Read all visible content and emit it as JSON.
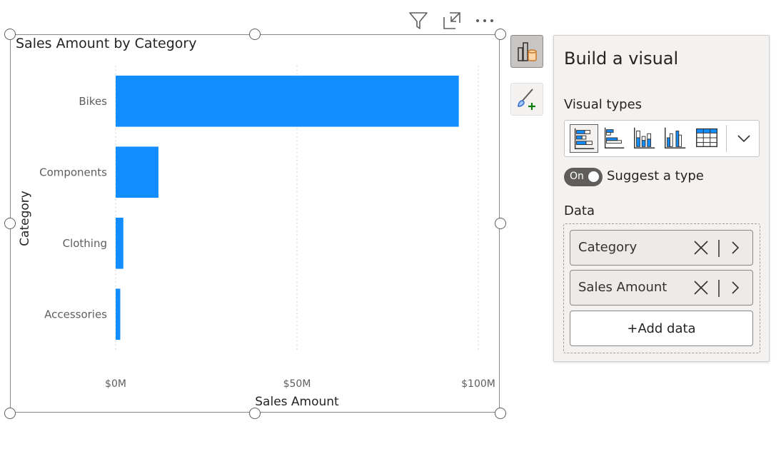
{
  "visual": {
    "title": "Sales Amount by Category"
  },
  "header_icons": [
    "filter-icon",
    "focus-mode-icon",
    "more-options-icon"
  ],
  "side_buttons": [
    "build-visual-icon",
    "format-visual-icon"
  ],
  "chart_data": {
    "type": "bar",
    "orientation": "horizontal",
    "title": "Sales Amount by Category",
    "categories": [
      "Bikes",
      "Components",
      "Clothing",
      "Accessories"
    ],
    "values": [
      94620526,
      11799077,
      2117613,
      1272057
    ],
    "xlabel": "Sales Amount",
    "ylabel": "Category",
    "xlim": [
      0,
      100000000
    ],
    "xticks": [
      0,
      50000000,
      100000000
    ],
    "xtick_labels": [
      "$0M",
      "$50M",
      "$100M"
    ],
    "grid": "vertical dotted",
    "bar_color": "#118dff"
  },
  "pane": {
    "title": "Build a visual",
    "visual_types_label": "Visual types",
    "visual_types": [
      "stacked-bar-chart-icon",
      "clustered-bar-chart-icon",
      "stacked-column-chart-icon",
      "clustered-column-chart-icon",
      "table-icon"
    ],
    "selected_visual_type": "stacked-bar-chart-icon",
    "toggle_state": "On",
    "suggest_label": "Suggest a type",
    "data_label": "Data",
    "fields": [
      "Category",
      "Sales Amount"
    ],
    "add_data_label": "+Add data"
  },
  "colors": {
    "accent": "#118dff",
    "frame": "#8a8886",
    "pane_bg": "#f3f2f1"
  }
}
